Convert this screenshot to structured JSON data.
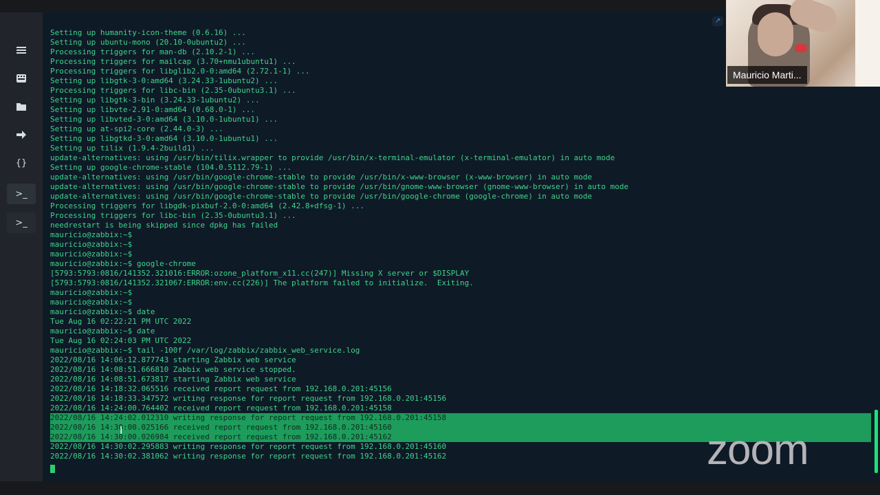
{
  "sidebar": {
    "items": [
      {
        "name": "menu",
        "icon": "≡"
      },
      {
        "name": "keyboard",
        "icon": "⌨"
      },
      {
        "name": "folder",
        "icon": "■"
      },
      {
        "name": "port-forward",
        "icon": "➜"
      },
      {
        "name": "snippets",
        "icon": "{}"
      },
      {
        "name": "terminal",
        "icon": ">_"
      },
      {
        "name": "terminal-session",
        "icon": ">_"
      }
    ]
  },
  "terminal": {
    "lines": [
      "Setting up humanity-icon-theme (0.6.16) ...",
      "Setting up ubuntu-mono (20.10-0ubuntu2) ...",
      "Processing triggers for man-db (2.10.2-1) ...",
      "Processing triggers for mailcap (3.70+nmu1ubuntu1) ...",
      "Processing triggers for libglib2.0-0:amd64 (2.72.1-1) ...",
      "Setting up libgtk-3-0:amd64 (3.24.33-1ubuntu2) ...",
      "Processing triggers for libc-bin (2.35-0ubuntu3.1) ...",
      "Setting up libgtk-3-bin (3.24.33-1ubuntu2) ...",
      "Setting up libvte-2.91-0:amd64 (0.68.0-1) ...",
      "Setting up libvted-3-0:amd64 (3.10.0-1ubuntu1) ...",
      "Setting up at-spi2-core (2.44.0-3) ...",
      "Setting up libgtkd-3-0:amd64 (3.10.0-1ubuntu1) ...",
      "Setting up tilix (1.9.4-2build1) ...",
      "update-alternatives: using /usr/bin/tilix.wrapper to provide /usr/bin/x-terminal-emulator (x-terminal-emulator) in auto mode",
      "Setting up google-chrome-stable (104.0.5112.79-1) ...",
      "update-alternatives: using /usr/bin/google-chrome-stable to provide /usr/bin/x-www-browser (x-www-browser) in auto mode",
      "update-alternatives: using /usr/bin/google-chrome-stable to provide /usr/bin/gnome-www-browser (gnome-www-browser) in auto mode",
      "update-alternatives: using /usr/bin/google-chrome-stable to provide /usr/bin/google-chrome (google-chrome) in auto mode",
      "Processing triggers for libgdk-pixbuf-2.0-0:amd64 (2.42.8+dfsg-1) ...",
      "Processing triggers for libc-bin (2.35-0ubuntu3.1) ...",
      "needrestart is being skipped since dpkg has failed",
      "mauricio@zabbix:~$",
      "mauricio@zabbix:~$",
      "mauricio@zabbix:~$",
      "mauricio@zabbix:~$ google-chrome",
      "[5793:5793:0816/141352.321016:ERROR:ozone_platform_x11.cc(247)] Missing X server or $DISPLAY",
      "[5793:5793:0816/141352.321067:ERROR:env.cc(226)] The platform failed to initialize.  Exiting.",
      "mauricio@zabbix:~$",
      "mauricio@zabbix:~$",
      "mauricio@zabbix:~$ date",
      "Tue Aug 16 02:22:21 PM UTC 2022",
      "mauricio@zabbix:~$ date",
      "Tue Aug 16 02:24:03 PM UTC 2022",
      "mauricio@zabbix:~$ tail -100f /var/log/zabbix/zabbix_web_service.log",
      "2022/08/16 14:06:12.877743 starting Zabbix web service",
      "2022/08/16 14:08:51.666810 Zabbix web service stopped.",
      "2022/08/16 14:08:51.673817 starting Zabbix web service",
      "2022/08/16 14:18:32.065516 received report request from 192.168.0.201:45156",
      "2022/08/16 14:18:33.347572 writing response for report request from 192.168.0.201:45156",
      "2022/08/16 14:24:00.764402 received report request from 192.168.0.201:45158",
      "2022/08/16 14:24:02.012310 writing response for report request from 192.168.0.201:45158",
      "2022/08/16 14:30:00.025166 received report request from 192.168.0.201:45160",
      "2022/08/16 14:30:00.026984 received report request from 192.168.0.201:45162",
      "2022/08/16 14:30:02.295883 writing response for report request from 192.168.0.201:45160",
      "2022/08/16 14:30:02.381062 writing response for report request from 192.168.0.201:45162"
    ],
    "selected_line_indices": [
      40,
      41,
      42
    ]
  },
  "video": {
    "participant_name": "Mauricio Marti..."
  },
  "watermark": {
    "text": "zoom"
  },
  "colors": {
    "terminal_bg": "#0f1a27",
    "terminal_text": "#3fd38a",
    "selection": "#1d9c5c",
    "sidebar_bg": "#21252b"
  }
}
